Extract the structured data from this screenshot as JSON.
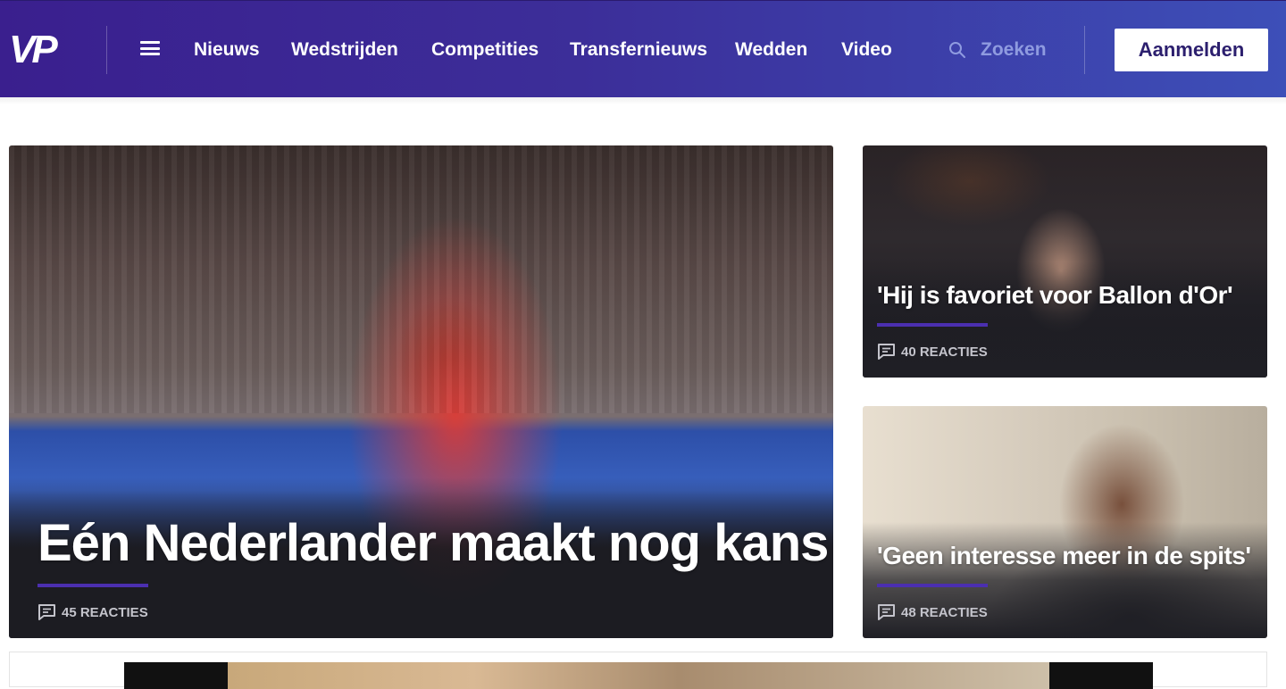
{
  "header": {
    "logo_text": "VP",
    "nav": [
      {
        "label": "Nieuws"
      },
      {
        "label": "Wedstrijden"
      },
      {
        "label": "Competities"
      },
      {
        "label": "Transfernieuws"
      },
      {
        "label": "Wedden"
      },
      {
        "label": "Video"
      }
    ],
    "search_label": "Zoeken",
    "login_label": "Aanmelden"
  },
  "articles": {
    "main": {
      "title": "Eén Nederlander maakt nog kans",
      "reacties": "45 REACTIES"
    },
    "side1": {
      "title": "'Hij is favoriet voor Ballon d'Or'",
      "reacties": "40 REACTIES"
    },
    "side2": {
      "title": "'Geen interesse meer in de spits'",
      "reacties": "48 REACTIES"
    }
  },
  "colors": {
    "header_start": "#3a1f8e",
    "header_end": "#3d4fb8",
    "accent": "#4b2fb0",
    "login_text": "#2c1f6e"
  },
  "icons": [
    "hamburger-icon",
    "search-icon",
    "comment-icon"
  ]
}
